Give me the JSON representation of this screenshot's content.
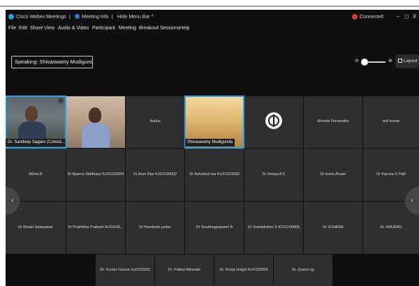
{
  "titlebar": {
    "app_title": "Cisco Webex Meetings",
    "sep1": "|",
    "meeting_info": "Meeting Info",
    "sep2": "|",
    "hide_menu_bar": "Hide Menu Bar ^",
    "connection_status": "Connected",
    "connection_mark": "•",
    "minimize": "–",
    "maximize": "◻",
    "close": "X"
  },
  "menubar": {
    "items": [
      "File",
      "Edit",
      "Share",
      "View",
      "Audio & Video",
      "Participant",
      "Meeting",
      "Breakout Sessions",
      "Help"
    ]
  },
  "speaking": {
    "label": "Speaking: Shivaswamy Mudigunda"
  },
  "view_controls": {
    "zoom_out": "⊖",
    "zoom_in": "⊕",
    "layout_label": "Layout"
  },
  "grid": {
    "row1": [
      {
        "name": "Dr. Sandeep Sagare (Cohost...)",
        "video": true,
        "selected": true
      },
      {
        "name": "",
        "video": true
      },
      {
        "name": "Aadya"
      },
      {
        "name": "Shivaswamy Mudigunda",
        "video": true,
        "selected": true
      },
      {
        "name": "",
        "logo": true
      },
      {
        "name": "Ahnista Fernandes"
      },
      {
        "name": "anil kumar"
      }
    ],
    "row2": [
      {
        "name": "Athira B"
      },
      {
        "name": "Dr Aparna Siddhaye KU01190004"
      },
      {
        "name": "Dr Arun Das KU01190002"
      },
      {
        "name": "Dr Ashutosh kar KU01220003"
      },
      {
        "name": "Dr Deepa A C"
      },
      {
        "name": "Dr Insha Ansari"
      },
      {
        "name": "Dr Karuna S Patil"
      }
    ],
    "row3": [
      {
        "name": "Dr Kinaki Gampawar"
      },
      {
        "name": "Dr Prathibha Prakash KU01190..."
      },
      {
        "name": "Dr Ramkesh yadav"
      },
      {
        "name": "Dr Soubhagyalaxmi B"
      },
      {
        "name": "Dr Sreelakshmi S KV01190005"
      },
      {
        "name": "Dr SUHERA"
      },
      {
        "name": "Dr. ANURAG"
      }
    ],
    "row4": [
      {
        "name": "Dr. Kumar Gaurav ku0120003"
      },
      {
        "name": "Dr. Pallavi Athavale"
      },
      {
        "name": "Dr. Pooja Hulgol KU0120003"
      },
      {
        "name": "Dr. Queen rjy"
      }
    ]
  },
  "nav": {
    "prev": "‹",
    "next": "›"
  },
  "colors": {
    "accent": "#25a4e7",
    "tile_bg": "#2f2f2f",
    "window_bg": "#0f0f0f",
    "connected_red": "#e0392b",
    "connected_green": "#39c262"
  }
}
